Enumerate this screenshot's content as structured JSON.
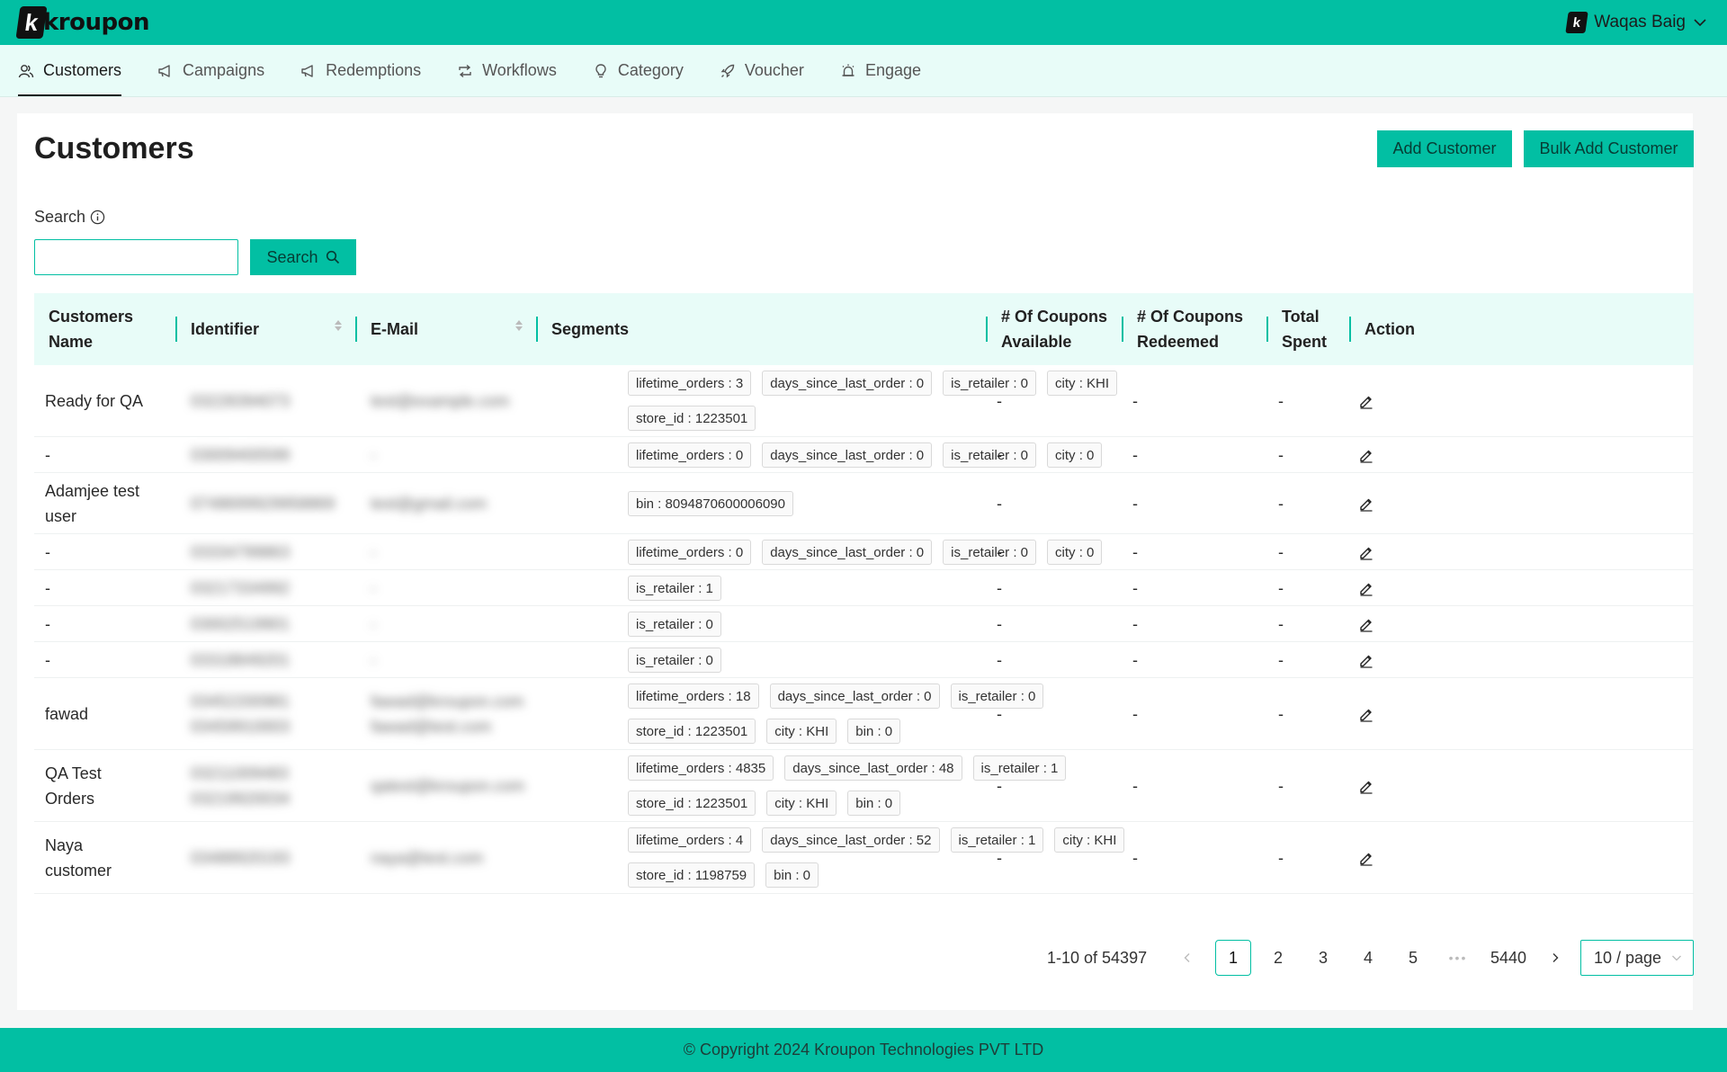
{
  "brand": {
    "logo_letter": "k",
    "logo_text": "kroupon"
  },
  "user": {
    "name": "Waqas Baig",
    "badge": "k"
  },
  "nav": [
    {
      "label": "Customers",
      "icon": "users-icon"
    },
    {
      "label": "Campaigns",
      "icon": "megaphone-icon"
    },
    {
      "label": "Redemptions",
      "icon": "megaphone-icon"
    },
    {
      "label": "Workflows",
      "icon": "retweet-icon"
    },
    {
      "label": "Category",
      "icon": "bulb-icon"
    },
    {
      "label": "Voucher",
      "icon": "rocket-icon"
    },
    {
      "label": "Engage",
      "icon": "alert-icon"
    }
  ],
  "page": {
    "title": "Customers",
    "add_button": "Add Customer",
    "bulk_button": "Bulk Add Customer",
    "search_label": "Search",
    "search_value": "",
    "search_button": "Search"
  },
  "table": {
    "columns": {
      "name": "Customers Name",
      "identifier": "Identifier",
      "email": "E-Mail",
      "segments": "Segments",
      "coupons_available": "# Of Coupons Available",
      "coupons_redeemed": "# Of Coupons Redeemed",
      "total_spent": "Total Spent",
      "action": "Action"
    },
    "rows": [
      {
        "name": "Ready for QA",
        "identifier": "03228394073",
        "email": "test@example.com",
        "segments": [
          "lifetime_orders : 3",
          "days_since_last_order : 0",
          "is_retailer : 0",
          "city : KHI",
          "store_id : 1223501"
        ],
        "available": "-",
        "redeemed": "-",
        "spent": "-"
      },
      {
        "name": "-",
        "identifier": "03009400599",
        "email": "-",
        "segments": [
          "lifetime_orders : 0",
          "days_since_last_order : 0",
          "is_retailer : 0",
          "city : 0"
        ],
        "available": "-",
        "redeemed": "-",
        "spent": "-"
      },
      {
        "name": "Adamjee test user",
        "identifier": "0748699929958869",
        "email": "test@gmail.com",
        "segments": [
          "bin : 8094870600006090"
        ],
        "available": "-",
        "redeemed": "-",
        "spent": "-"
      },
      {
        "name": "-",
        "identifier": "03334799863",
        "email": "-",
        "segments": [
          "lifetime_orders : 0",
          "days_since_last_order : 0",
          "is_retailer : 0",
          "city : 0"
        ],
        "available": "-",
        "redeemed": "-",
        "spent": "-"
      },
      {
        "name": "-",
        "identifier": "03217334992",
        "email": "-",
        "segments": [
          "is_retailer : 1"
        ],
        "available": "-",
        "redeemed": "-",
        "spent": "-"
      },
      {
        "name": "-",
        "identifier": "03002519901",
        "email": "-",
        "segments": [
          "is_retailer : 0"
        ],
        "available": "-",
        "redeemed": "-",
        "spent": "-"
      },
      {
        "name": "-",
        "identifier": "03318849201",
        "email": "-",
        "segments": [
          "is_retailer : 0"
        ],
        "available": "-",
        "redeemed": "-",
        "spent": "-"
      },
      {
        "name": "fawad",
        "identifier": "03452200981 03459910003",
        "email": "fawad@kroupon.com fawad@test.com",
        "segments": [
          "lifetime_orders : 18",
          "days_since_last_order : 0",
          "is_retailer : 0",
          "store_id : 1223501",
          "city : KHI",
          "bin : 0"
        ],
        "available": "-",
        "redeemed": "-",
        "spent": "-"
      },
      {
        "name": "QA Test Orders",
        "identifier": "03211009483 03219920034",
        "email": "qatest@kroupon.com",
        "segments": [
          "lifetime_orders : 4835",
          "days_since_last_order : 48",
          "is_retailer : 1",
          "store_id : 1223501",
          "city : KHI",
          "bin : 0"
        ],
        "available": "-",
        "redeemed": "-",
        "spent": "-"
      },
      {
        "name": "Naya customer",
        "identifier": "03488920193",
        "email": "naya@test.com",
        "segments": [
          "lifetime_orders : 4",
          "days_since_last_order : 52",
          "is_retailer : 1",
          "city : KHI",
          "store_id : 1198759",
          "bin : 0"
        ],
        "available": "-",
        "redeemed": "-",
        "spent": "-"
      }
    ]
  },
  "pagination": {
    "total_text": "1-10 of 54397",
    "pages": [
      "1",
      "2",
      "3",
      "4",
      "5"
    ],
    "ellipsis": "•••",
    "last_page": "5440",
    "page_size": "10 / page",
    "current": "1"
  },
  "footer": {
    "text": "© Copyright 2024 Kroupon Technologies PVT LTD"
  },
  "colors": {
    "primary": "#02bfa3",
    "nav_bg": "#e8fcf8",
    "text": "#222222"
  }
}
